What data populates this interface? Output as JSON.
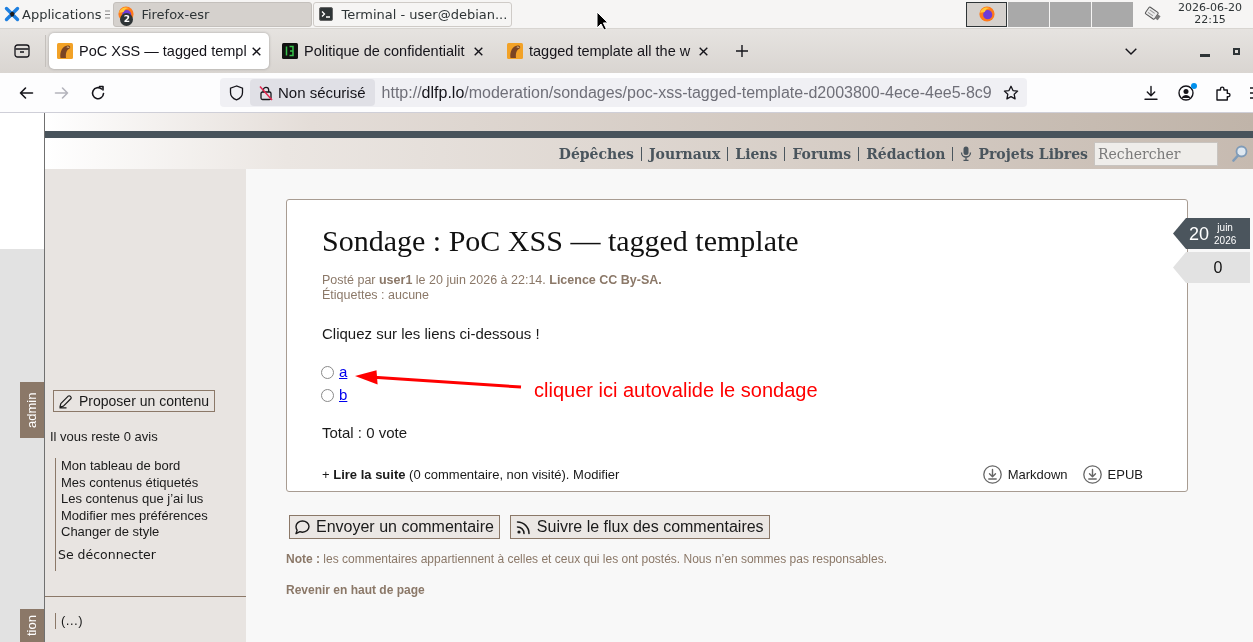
{
  "taskbar": {
    "menu_label": "Applications",
    "windows": [
      {
        "kind": "browser",
        "title": "Firefox-esr",
        "badge": "2",
        "selected": true
      },
      {
        "kind": "terminal",
        "title": "Terminal - user@debian...",
        "selected": false
      }
    ],
    "workspaces": [
      {
        "selected": true
      },
      {
        "selected": false
      },
      {
        "selected": false
      },
      {
        "selected": false
      }
    ],
    "clock": {
      "date": "2026-06-20",
      "time": "22:15"
    }
  },
  "browser": {
    "tabs": [
      {
        "kind": "site",
        "title": "PoC XSS — tagged templ",
        "selected": true
      },
      {
        "kind": "terminal",
        "title": "Politique de confidentialit",
        "selected": false
      },
      {
        "kind": "site",
        "title": "tagged template all the w",
        "selected": false
      }
    ],
    "nav": [
      {
        "kind": "back",
        "disabled": false
      },
      {
        "kind": "forward",
        "disabled": true
      },
      {
        "kind": "reload",
        "disabled": false
      }
    ],
    "security_label": "Non sécurisé",
    "url": {
      "scheme": "http://",
      "host": "dlfp.lo",
      "path": "/moderation/sondages/poc-xss-tagged-template-d2003800-4ece-4ee5-8c9"
    },
    "account_notification": true
  },
  "site": {
    "nav": [
      {
        "kind": "link",
        "label": "Dépêches"
      },
      {
        "kind": "link",
        "label": "Journaux"
      },
      {
        "kind": "link",
        "label": "Liens"
      },
      {
        "kind": "link",
        "label": "Forums"
      },
      {
        "kind": "link",
        "label": "Rédaction"
      },
      {
        "kind": "podcast",
        "label": "Projets Libres"
      }
    ],
    "search": {
      "placeholder": "Rechercher"
    }
  },
  "sidebar": {
    "tabs": [
      {
        "label": "admin"
      },
      {
        "label": "tion"
      }
    ],
    "propose_button": "Proposer un contenu",
    "notice": "Il vous reste 0 avis",
    "menu": [
      "Mon tableau de bord",
      "Mes contenus étiquetés",
      "Les contenus que j’ai lus",
      "Modifier mes préférences",
      "Changer de style"
    ],
    "logout": "Se déconnecter",
    "more": "(…)"
  },
  "article": {
    "title": "Sondage : PoC XSS — tagged template",
    "meta": "Posté par **user1** le 20 juin 2026 à 22:14. **Licence CC By-SA.**",
    "tags": "Étiquettes : aucune",
    "date": {
      "day": "20",
      "month": "juin",
      "year": "2026"
    },
    "comment_count": "0",
    "intro": "Cliquez sur les liens ci-dessous !",
    "options": [
      {
        "label": "a",
        "checked": false
      },
      {
        "label": "b",
        "checked": false
      }
    ],
    "total": "Total : 0 vote",
    "footer": {
      "prefix": "+",
      "read_more": "Lire la suite",
      "info": "(0 commentaire, non visité).",
      "edit": "Modifier"
    },
    "exports": [
      {
        "label": "Markdown"
      },
      {
        "label": "EPUB"
      }
    ]
  },
  "annotation": {
    "text": "cliquer ici autovalide le sondage"
  },
  "actions": [
    {
      "kind": "comment",
      "label": "Envoyer un commentaire"
    },
    {
      "kind": "feed",
      "label": "Suivre le flux des commentaires"
    }
  ],
  "note": "**Note :** les commentaires appartiennent à celles et ceux qui les ont postés. Nous n’en sommes pas responsables.",
  "back_to_top": "Revenir en haut de page"
}
